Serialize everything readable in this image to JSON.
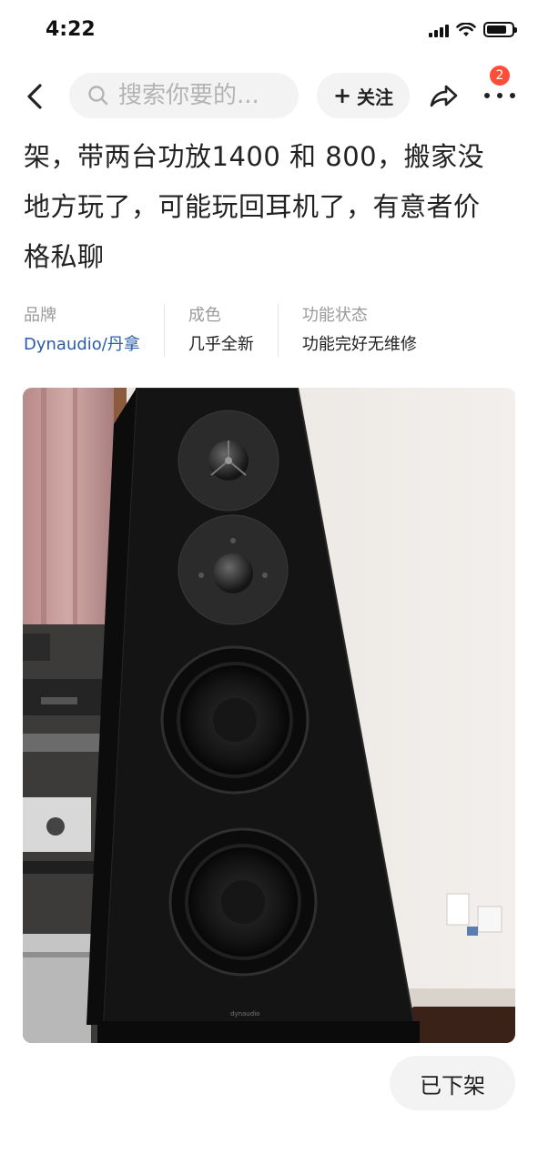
{
  "status_bar": {
    "time": "4:22",
    "icons": [
      "signal-icon",
      "wifi-icon",
      "battery-icon"
    ]
  },
  "nav": {
    "back_icon": "chevron-left-icon",
    "search_placeholder": "搜索你要的...",
    "follow_label": "关注",
    "share_icon": "share-icon",
    "more_icon": "more-dots-icon",
    "notification_count": "2"
  },
  "description": {
    "line1": "架，带两台功放1400 和 800，搬家没",
    "line2": "地方玩了，可能玩回耳机了，有意者价",
    "line3": "格私聊"
  },
  "attributes": [
    {
      "label": "品牌",
      "value": "Dynaudio/丹拿"
    },
    {
      "label": "成色",
      "value": "几乎全新"
    },
    {
      "label": "功能状态",
      "value": "功能完好无维修"
    }
  ],
  "photo": {
    "brand_mark": "dynaudio"
  },
  "footer": {
    "delisted_label": "已下架"
  },
  "colors": {
    "brand_link": "#2a5ba8",
    "badge": "#ff4d3a",
    "pill_bg": "#f3f3f3"
  }
}
